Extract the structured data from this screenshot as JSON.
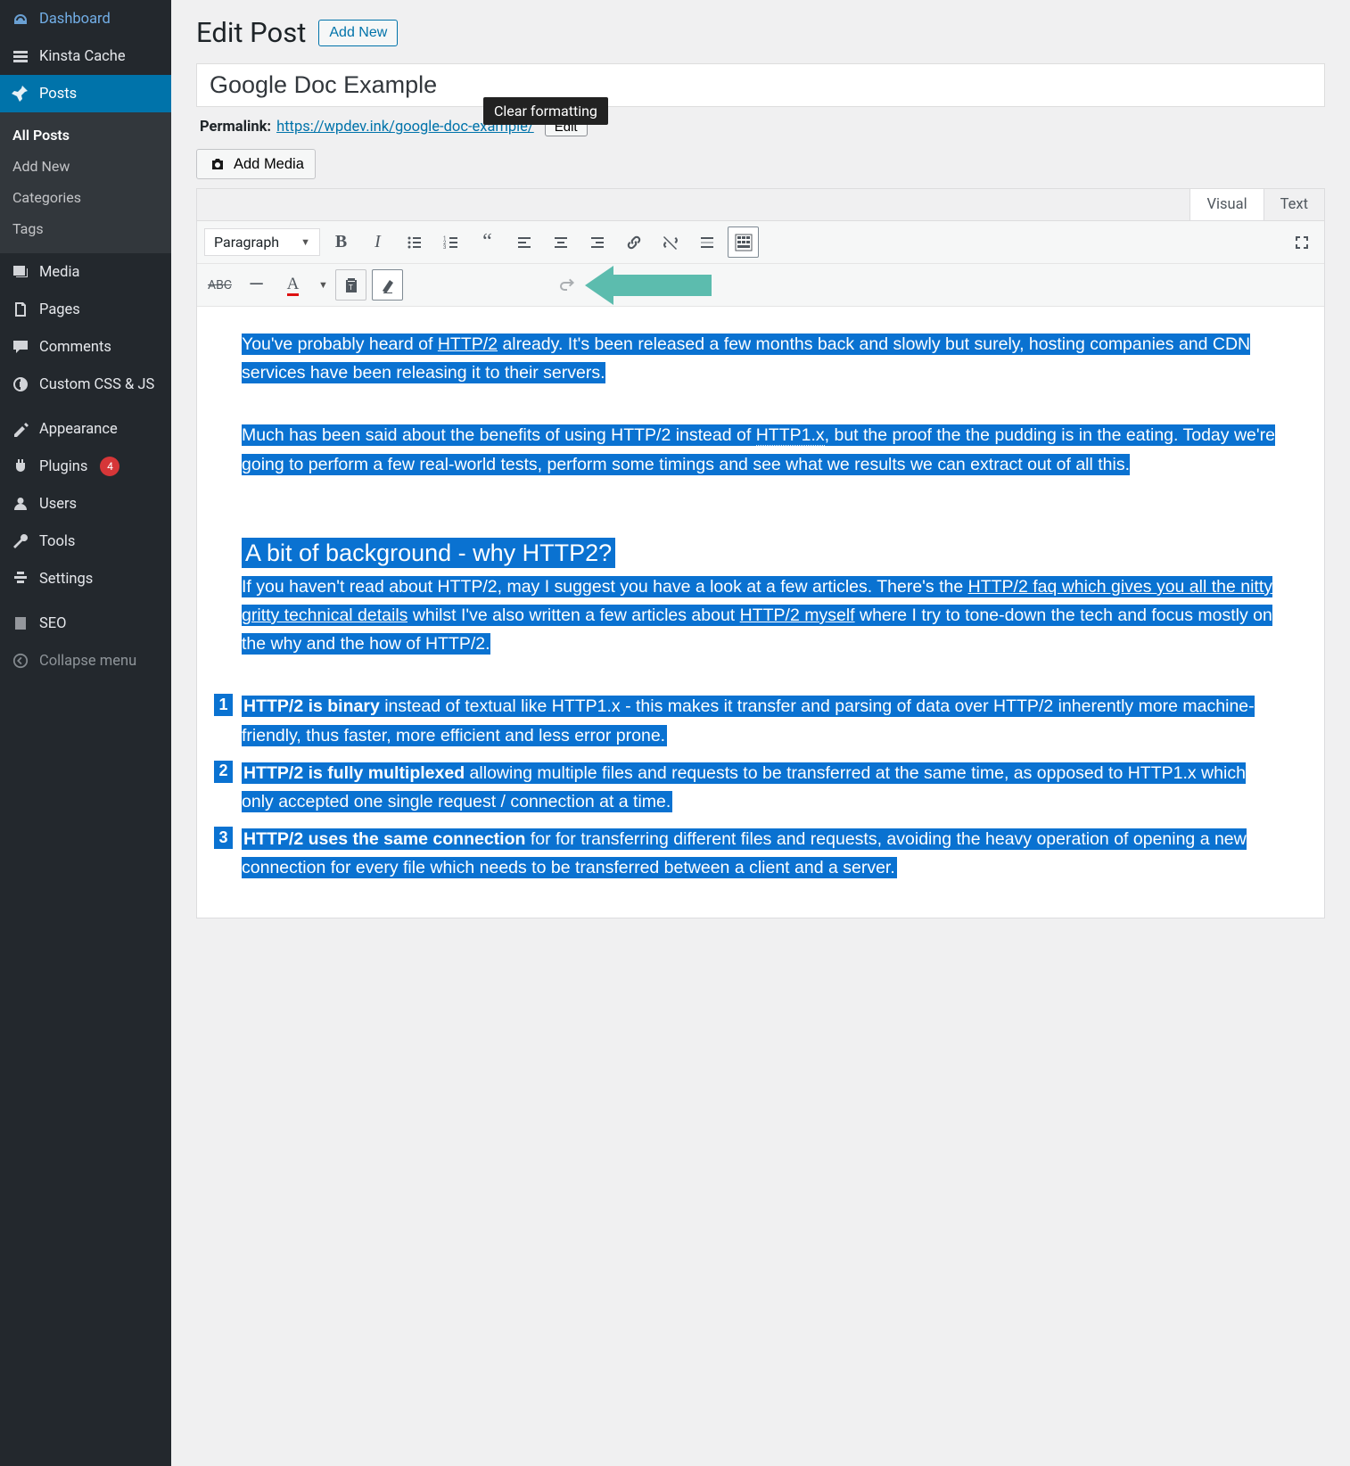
{
  "sidebar": {
    "items": [
      {
        "icon": "dashboard-icon",
        "label": "Dashboard"
      },
      {
        "icon": "cache-icon",
        "label": "Kinsta Cache"
      }
    ],
    "posts": {
      "label": "Posts",
      "sub": [
        {
          "label": "All Posts",
          "highlight": true
        },
        {
          "label": "Add New"
        },
        {
          "label": "Categories"
        },
        {
          "label": "Tags"
        }
      ]
    },
    "after": [
      {
        "icon": "media-icon",
        "label": "Media"
      },
      {
        "icon": "pages-icon",
        "label": "Pages"
      },
      {
        "icon": "comments-icon",
        "label": "Comments"
      },
      {
        "icon": "css-icon",
        "label": "Custom CSS & JS"
      }
    ],
    "after2": [
      {
        "icon": "appearance-icon",
        "label": "Appearance"
      },
      {
        "icon": "plugins-icon",
        "label": "Plugins",
        "badge": "4"
      },
      {
        "icon": "users-icon",
        "label": "Users"
      },
      {
        "icon": "tools-icon",
        "label": "Tools"
      },
      {
        "icon": "settings-icon",
        "label": "Settings"
      }
    ],
    "after3": [
      {
        "icon": "seo-icon",
        "label": "SEO"
      }
    ],
    "collapse": {
      "label": "Collapse menu"
    }
  },
  "header": {
    "title": "Edit Post",
    "add_new": "Add New"
  },
  "post": {
    "title_value": "Google Doc Example",
    "permalink_label": "Permalink:",
    "permalink_base": "https://wpdev.ink/",
    "permalink_slug": "google-doc-example/",
    "edit_label": "Edit",
    "add_media": "Add Media"
  },
  "tabs": {
    "visual": "Visual",
    "text": "Text"
  },
  "toolbar": {
    "format_value": "Paragraph",
    "tooltip": "Clear formatting"
  },
  "content": {
    "p1": {
      "a": "You've probably heard of ",
      "link1": "HTTP/2",
      "b": " already. It's been released a few months back and slowly but surely, hosting companies and CDN services have been releasing it to their servers."
    },
    "p2": {
      "a": "Much has been said about the benefits of using HTTP/2 instead of ",
      "dotted1": "HTTP1.x",
      "b": ", but the proof the the pudding is in the eating. Today we're going to perform a few real-world tests, perform some timings and see what we results we can extract out of all this."
    },
    "h2_1": "A bit of background - why HTTP2?",
    "p3": {
      "a": "If you haven't read about HTTP/2, may I suggest you have a look at a few articles. There's the ",
      "link1": "HTTP/2 faq which gives you all the nitty gritty technical details",
      "b": " whilst I've also written a few articles about ",
      "link2": "HTTP/2 myself",
      "c": " where I try to tone-down the tech and focus mostly on the why and the how of HTTP/2."
    },
    "li1": {
      "bold": "HTTP/2 is binary",
      "rest": " instead of textual like HTTP1.x - this makes it transfer and parsing of data over HTTP/2 inherently more machine-friendly, thus faster, more efficient and less error prone."
    },
    "li2": {
      "bold": "HTTP/2 is fully multiplexed",
      "rest": " allowing multiple files and requests to be transferred at the same time, as opposed to HTTP1.x which only accepted one single request / connection at a time."
    },
    "li3": {
      "bold": " HTTP/2 uses the same connection",
      "rest": " for for transferring different files and requests, avoiding the heavy operation of opening a new connection for every file which needs to be transferred between a client and a server."
    }
  }
}
